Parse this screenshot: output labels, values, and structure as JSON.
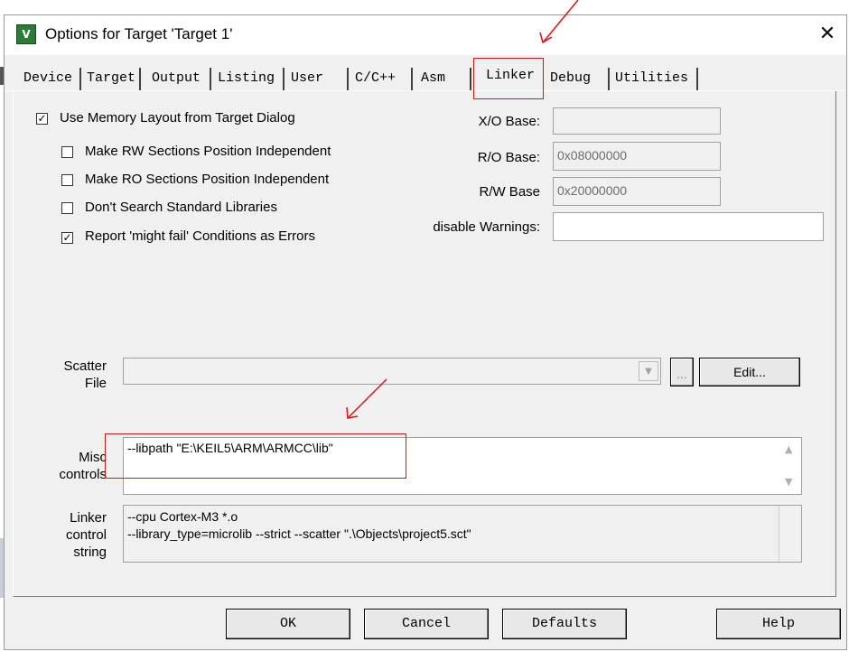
{
  "window": {
    "title": "Options for Target 'Target 1'",
    "icon": "keil-uvision-icon"
  },
  "tabs": [
    {
      "label": "Device"
    },
    {
      "label": "Target"
    },
    {
      "label": "Output"
    },
    {
      "label": "Listing"
    },
    {
      "label": "User"
    },
    {
      "label": "C/C++"
    },
    {
      "label": "Asm"
    },
    {
      "label": "Linker",
      "active": true
    },
    {
      "label": "Debug"
    },
    {
      "label": "Utilities"
    }
  ],
  "options": {
    "use_memory_layout": {
      "label": "Use Memory Layout from Target Dialog",
      "checked": true
    },
    "rw_independent": {
      "label": "Make RW Sections Position Independent",
      "checked": false
    },
    "ro_independent": {
      "label": "Make RO Sections Position Independent",
      "checked": false
    },
    "no_std_libs": {
      "label": "Don't Search Standard Libraries",
      "checked": false
    },
    "might_fail_errors": {
      "label": "Report 'might fail' Conditions as Errors",
      "checked": true
    }
  },
  "bases": {
    "xo": {
      "label": "X/O Base:",
      "value": ""
    },
    "ro": {
      "label": "R/O Base:",
      "value": "0x08000000"
    },
    "rw": {
      "label": "R/W Base",
      "value": "0x20000000"
    },
    "warnings": {
      "label": "disable Warnings:",
      "value": ""
    }
  },
  "scatter": {
    "label_line1": "Scatter",
    "label_line2": "File",
    "value": "",
    "browse_label": "...",
    "edit_label": "Edit..."
  },
  "misc": {
    "label_line1": "Misc",
    "label_line2": "controls",
    "value": "--libpath \"E:\\KEIL5\\ARM\\ARMCC\\lib\""
  },
  "linker_string": {
    "label_line1": "Linker",
    "label_line2": "control",
    "label_line3": "string",
    "line1": "--cpu Cortex-M3 *.o",
    "line2": "--library_type=microlib --strict --scatter \".\\Objects\\project5.sct\""
  },
  "buttons": {
    "ok": "OK",
    "cancel": "Cancel",
    "defaults": "Defaults",
    "help": "Help"
  },
  "colors": {
    "annotation": "#e01010",
    "window_bg": "#f0f0f0"
  }
}
